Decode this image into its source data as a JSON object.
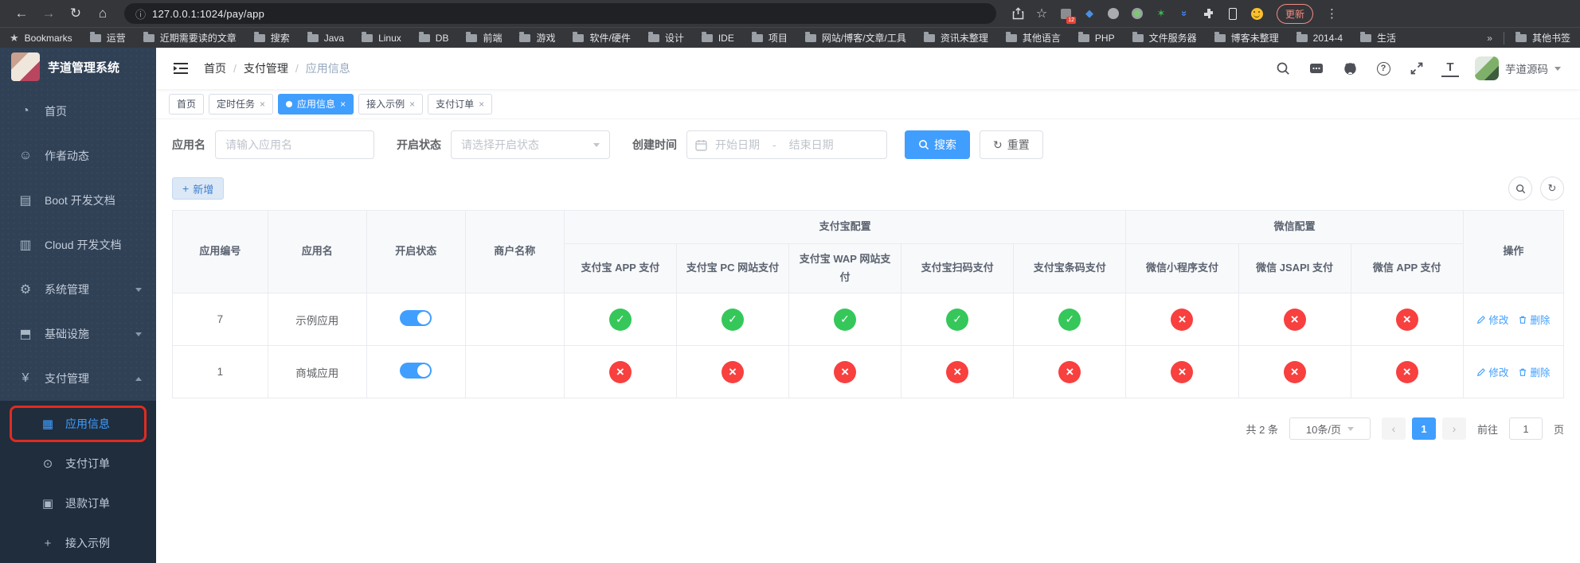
{
  "browser": {
    "url": "127.0.0.1:1024/pay/app",
    "update_label": "更新",
    "bookmarks_label": "Bookmarks",
    "bookmarks": [
      "运营",
      "近期需要读的文章",
      "搜索",
      "Java",
      "Linux",
      "DB",
      "前端",
      "游戏",
      "软件/硬件",
      "设计",
      "IDE",
      "项目",
      "网站/博客/文章/工具",
      "资讯未整理",
      "其他语言",
      "PHP",
      "文件服务器",
      "博客未整理",
      "2014-4",
      "生活"
    ],
    "bookmarks_overflow": "»",
    "other_bookmarks": "其他书签",
    "extension_badge": "12"
  },
  "icons": {
    "dashboard-icon": "◔",
    "user-icon": "☺",
    "book-icon": "▤",
    "document-icon": "▥",
    "gear-icon": "⚙",
    "monitor-icon": "⬒",
    "yen-icon": "¥",
    "grid-icon": "▦",
    "order-icon": "⊙",
    "refund-icon": "▣",
    "demo-icon": "+"
  },
  "sidebar": {
    "title": "芋道管理系统",
    "items": [
      {
        "label": "首页",
        "icon": "dashboard-icon",
        "expandable": false
      },
      {
        "label": "作者动态",
        "icon": "user-icon",
        "expandable": false
      },
      {
        "label": "Boot 开发文档",
        "icon": "book-icon",
        "expandable": false
      },
      {
        "label": "Cloud 开发文档",
        "icon": "document-icon",
        "expandable": false
      },
      {
        "label": "系统管理",
        "icon": "gear-icon",
        "expandable": true,
        "expanded": false
      },
      {
        "label": "基础设施",
        "icon": "monitor-icon",
        "expandable": true,
        "expanded": false
      },
      {
        "label": "支付管理",
        "icon": "yen-icon",
        "expandable": true,
        "expanded": true
      }
    ],
    "submenu": [
      {
        "label": "应用信息",
        "icon": "grid-icon",
        "active": true,
        "annotated": true
      },
      {
        "label": "支付订单",
        "icon": "order-icon",
        "active": false,
        "annotated": false
      },
      {
        "label": "退款订单",
        "icon": "refund-icon",
        "active": false,
        "annotated": false
      },
      {
        "label": "接入示例",
        "icon": "demo-icon",
        "active": false,
        "annotated": false
      }
    ]
  },
  "header": {
    "breadcrumb": [
      "首页",
      "支付管理",
      "应用信息"
    ],
    "user_name": "芋道源码"
  },
  "tabs": [
    {
      "label": "首页",
      "closable": false,
      "active": false
    },
    {
      "label": "定时任务",
      "closable": true,
      "active": false
    },
    {
      "label": "应用信息",
      "closable": true,
      "active": true
    },
    {
      "label": "接入示例",
      "closable": true,
      "active": false
    },
    {
      "label": "支付订单",
      "closable": true,
      "active": false
    }
  ],
  "filters": {
    "app_name_label": "应用名",
    "app_name_placeholder": "请输入应用名",
    "status_label": "开启状态",
    "status_placeholder": "请选择开启状态",
    "create_time_label": "创建时间",
    "date_start_placeholder": "开始日期",
    "date_separator": "-",
    "date_end_placeholder": "结束日期",
    "search_label": "搜索",
    "reset_label": "重置"
  },
  "toolbar": {
    "add_label": "新增"
  },
  "table": {
    "columns": [
      "应用编号",
      "应用名",
      "开启状态",
      "商户名称"
    ],
    "groups": [
      {
        "label": "支付宝配置",
        "children": [
          "支付宝 APP 支付",
          "支付宝 PC 网站支付",
          "支付宝 WAP 网站支付",
          "支付宝扫码支付",
          "支付宝条码支付"
        ]
      },
      {
        "label": "微信配置",
        "children": [
          "微信小程序支付",
          "微信 JSAPI 支付",
          "微信 APP 支付"
        ]
      }
    ],
    "action_column": "操作",
    "rows": [
      {
        "id": "7",
        "name": "示例应用",
        "enabled": true,
        "merchant": "",
        "channels": [
          true,
          true,
          true,
          true,
          true,
          false,
          false,
          false
        ]
      },
      {
        "id": "1",
        "name": "商城应用",
        "enabled": true,
        "merchant": "",
        "channels": [
          false,
          false,
          false,
          false,
          false,
          false,
          false,
          false
        ]
      }
    ],
    "edit_label": "修改",
    "delete_label": "删除"
  },
  "pagination": {
    "total_text": "共 2 条",
    "page_size": "10条/页",
    "current_page": "1",
    "goto_label": "前往",
    "goto_value": "1",
    "page_label": "页"
  },
  "colors": {
    "primary": "#409eff",
    "success": "#35c75a",
    "danger": "#f8403f",
    "sidebar": "#304156",
    "submenu": "#1f2d3d"
  }
}
